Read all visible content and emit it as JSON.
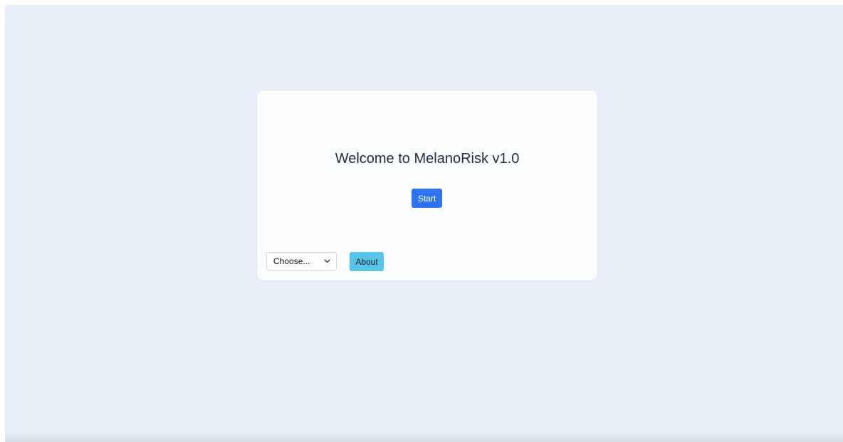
{
  "welcome": {
    "title": "Welcome to MelanoRisk v1.0",
    "start_label": "Start"
  },
  "footer": {
    "language_select": {
      "selected": "Choose..."
    },
    "about_label": "About"
  },
  "icons": {
    "select_arrow": "chevron-down-icon"
  },
  "colors": {
    "background": "#e8eff8",
    "card": "#fcfdff",
    "start_button": "#2f73f0",
    "about_button": "#5ac3e8",
    "title_text": "#1f2a44"
  }
}
